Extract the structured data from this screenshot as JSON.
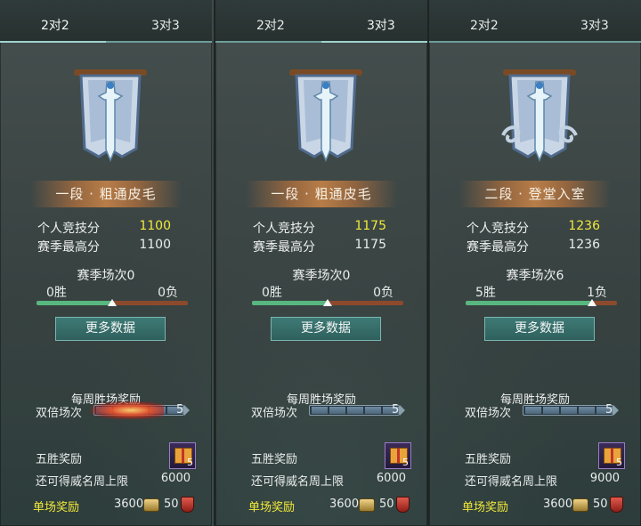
{
  "colors": {
    "highlight": "#f1e93a",
    "win_bar": "#58b77f",
    "loss_bar": "#8c4a2d",
    "tab_line": "#6d9e9a"
  },
  "panels": [
    {
      "tabs": {
        "two": "2对2",
        "three": "3对3"
      },
      "rank": "一段 · 粗通皮毛",
      "score_label": "个人竞技分",
      "score": "1100",
      "best_label": "赛季最高分",
      "best": "1100",
      "season_matches": "赛季场次0",
      "wins": "0胜",
      "losses": "0负",
      "win_fraction": 0.5,
      "more_button": "更多数据",
      "weekly_title": "每周胜场奖励",
      "double_label": "双倍场次",
      "double_count": "5",
      "double_progress": 0.4,
      "five_win_label": "五胜奖励",
      "chest_count": "5",
      "cap_label": "还可得威名周上限",
      "cap": "6000",
      "single_label": "单场奖励",
      "coin": "3600",
      "honor": "50",
      "emblem_icon": "sword-banner-icon"
    },
    {
      "tabs": {
        "two": "2对2",
        "three": "3对3"
      },
      "rank": "一段 · 粗通皮毛",
      "score_label": "个人竞技分",
      "score": "1175",
      "best_label": "赛季最高分",
      "best": "1175",
      "season_matches": "赛季场次0",
      "wins": "0胜",
      "losses": "0负",
      "win_fraction": 0.5,
      "more_button": "更多数据",
      "weekly_title": "每周胜场奖励",
      "double_label": "双倍场次",
      "double_count": "5",
      "double_progress": 0.0,
      "five_win_label": "五胜奖励",
      "chest_count": "5",
      "cap_label": "还可得威名周上限",
      "cap": "6000",
      "single_label": "单场奖励",
      "coin": "3600",
      "honor": "50",
      "emblem_icon": "sword-banner-icon"
    },
    {
      "tabs": {
        "two": "2对2",
        "three": "3对3"
      },
      "rank": "二段 · 登堂入室",
      "score_label": "个人竞技分",
      "score": "1236",
      "best_label": "赛季最高分",
      "best": "1236",
      "season_matches": "赛季场次6",
      "wins": "5胜",
      "losses": "1负",
      "win_fraction": 0.8333,
      "more_button": "更多数据",
      "weekly_title": "每周胜场奖励",
      "double_label": "双倍场次",
      "double_count": "5",
      "double_progress": 0.0,
      "five_win_label": "五胜奖励",
      "chest_count": "5",
      "cap_label": "还可得威名周上限",
      "cap": "9000",
      "single_label": "单场奖励",
      "coin": "3600",
      "honor": "50",
      "emblem_icon": "sword-banner-cloud-icon"
    }
  ]
}
